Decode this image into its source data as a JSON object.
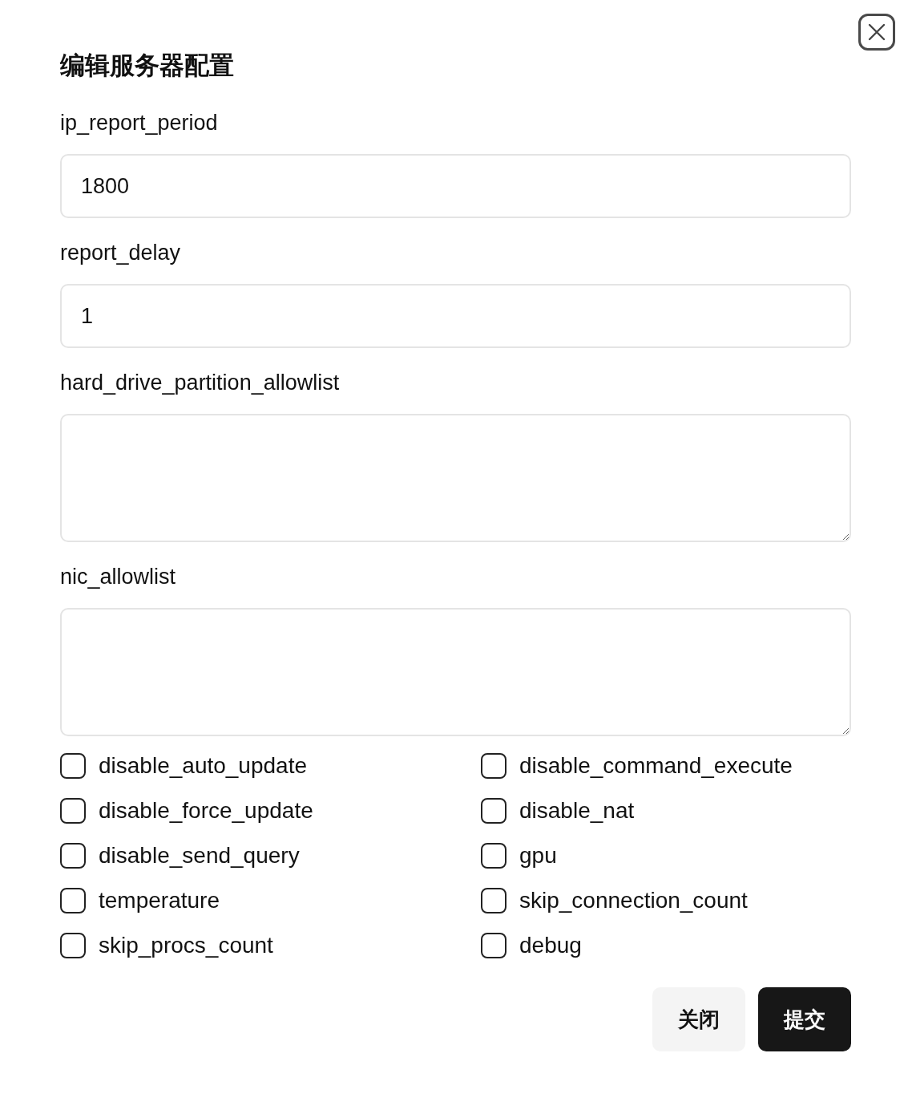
{
  "dialog": {
    "title": "编辑服务器配置"
  },
  "fields": [
    {
      "kind": "input",
      "label": "ip_report_period",
      "value": "1800"
    },
    {
      "kind": "input",
      "label": "report_delay",
      "value": "1"
    },
    {
      "kind": "textarea",
      "label": "hard_drive_partition_allowlist"
    },
    {
      "kind": "textarea",
      "label": "nic_allowlist"
    }
  ],
  "options": [
    {
      "label": "disable_auto_update",
      "checked": false
    },
    {
      "label": "disable_command_execute",
      "checked": false
    },
    {
      "label": "disable_force_update",
      "checked": false
    },
    {
      "label": "disable_nat",
      "checked": false
    },
    {
      "label": "disable_send_query",
      "checked": false
    },
    {
      "label": "gpu",
      "checked": false
    },
    {
      "label": "temperature",
      "checked": false
    },
    {
      "label": "skip_connection_count",
      "checked": false
    },
    {
      "label": "skip_procs_count",
      "checked": false
    },
    {
      "label": "debug",
      "checked": false
    }
  ],
  "buttons": [
    {
      "kind": "secondary",
      "label": "关闭"
    },
    {
      "kind": "primary",
      "label": "提交"
    }
  ]
}
